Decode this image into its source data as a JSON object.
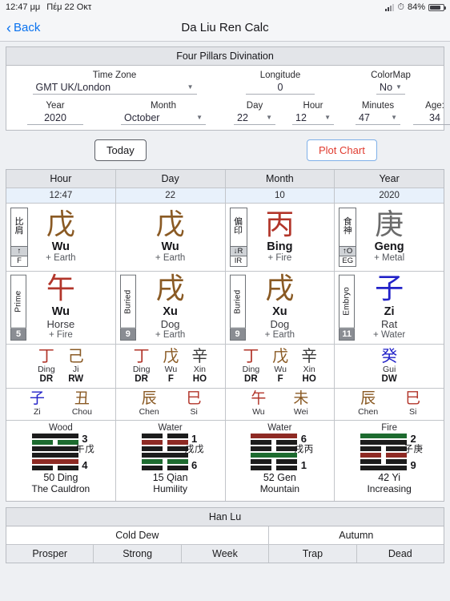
{
  "status_bar": {
    "time": "12:47 μμ",
    "date": "Πέμ 22 Οκτ",
    "battery": "84%",
    "signal_icon": "cellular-signal-icon",
    "wifi_icon": "wifi-icon",
    "battery_icon": "battery-icon"
  },
  "nav": {
    "back_label": "Back",
    "back_icon": "chevron-left-icon",
    "title": "Da Liu Ren Calc"
  },
  "form": {
    "title": "Four Pillars Divination",
    "timezone": {
      "label": "Time Zone",
      "value": "GMT UK/London"
    },
    "longitude": {
      "label": "Longitude",
      "value": "0"
    },
    "colormap": {
      "label": "ColorMap",
      "value": "No"
    },
    "year": {
      "label": "Year",
      "value": "2020"
    },
    "month": {
      "label": "Month",
      "value": "October"
    },
    "day": {
      "label": "Day",
      "value": "22"
    },
    "hour": {
      "label": "Hour",
      "value": "12"
    },
    "minutes": {
      "label": "Minutes",
      "value": "47"
    },
    "age": {
      "label": "Age:",
      "value": "34"
    }
  },
  "buttons": {
    "today": "Today",
    "plot_chart": "Plot Chart"
  },
  "colors": {
    "wood": "#1d6b2f",
    "fire": "#b2352a",
    "earth": "#8a5a24",
    "metal": "#6b6b6b",
    "water": "#2222c8",
    "accent_blue": "#0a72ef",
    "plot_red": "#e03b2f"
  },
  "chart_data": {
    "type": "table",
    "title": "Four Pillars Divination chart",
    "columns": [
      "Hour",
      "Day",
      "Month",
      "Year"
    ],
    "subvalues": [
      "12:47",
      "22",
      "10",
      "2020"
    ],
    "stems": [
      {
        "cn": "戊",
        "pinyin": "Wu",
        "element": "+ Earth",
        "color": "#8a5a24",
        "badge": {
          "cn": "比肩",
          "mid": "↑",
          "bot": "F"
        }
      },
      {
        "cn": "戊",
        "pinyin": "Wu",
        "element": "+ Earth",
        "color": "#8a5a24",
        "badge": null
      },
      {
        "cn": "丙",
        "pinyin": "Bing",
        "element": "+ Fire",
        "color": "#b2352a",
        "badge": {
          "cn": "偏印",
          "mid": "↓R",
          "bot": "IR"
        }
      },
      {
        "cn": "庚",
        "pinyin": "Geng",
        "element": "+ Metal",
        "color": "#6b6b6b",
        "badge": {
          "cn": "食神",
          "mid": "↑O",
          "bot": "EG"
        }
      }
    ],
    "branches": [
      {
        "cn": "午",
        "pinyin": "Wu",
        "animal": "Horse",
        "element": "+ Fire",
        "color": "#b2352a",
        "badge": {
          "text": "Prime",
          "num": "5"
        }
      },
      {
        "cn": "戌",
        "pinyin": "Xu",
        "animal": "Dog",
        "element": "+ Earth",
        "color": "#8a5a24",
        "badge": {
          "text": "Buried",
          "num": "9"
        }
      },
      {
        "cn": "戌",
        "pinyin": "Xu",
        "animal": "Dog",
        "element": "+ Earth",
        "color": "#8a5a24",
        "badge": {
          "text": "Buried",
          "num": "9"
        }
      },
      {
        "cn": "子",
        "pinyin": "Zi",
        "animal": "Rat",
        "element": "+ Water",
        "color": "#2222c8",
        "badge": {
          "text": "Embryo",
          "num": "11"
        }
      }
    ],
    "hidden_stems": [
      [
        {
          "cn": "丁",
          "pinyin": "Ding",
          "abbr": "DR",
          "color": "#b2352a"
        },
        {
          "cn": "己",
          "pinyin": "Ji",
          "abbr": "RW",
          "color": "#8a5a24"
        }
      ],
      [
        {
          "cn": "丁",
          "pinyin": "Ding",
          "abbr": "DR",
          "color": "#b2352a"
        },
        {
          "cn": "戊",
          "pinyin": "Wu",
          "abbr": "F",
          "color": "#8a5a24"
        },
        {
          "cn": "辛",
          "pinyin": "Xin",
          "abbr": "HO",
          "color": "#3a3a3a"
        }
      ],
      [
        {
          "cn": "丁",
          "pinyin": "Ding",
          "abbr": "DR",
          "color": "#b2352a"
        },
        {
          "cn": "戊",
          "pinyin": "Wu",
          "abbr": "F",
          "color": "#8a5a24"
        },
        {
          "cn": "辛",
          "pinyin": "Xin",
          "abbr": "HO",
          "color": "#3a3a3a"
        }
      ],
      [
        {
          "cn": "癸",
          "pinyin": "Gui",
          "abbr": "DW",
          "color": "#2222c8"
        }
      ]
    ],
    "extra_branches": [
      [
        {
          "cn": "子",
          "pinyin": "Zi",
          "color": "#2222c8"
        },
        {
          "cn": "丑",
          "pinyin": "Chou",
          "color": "#8a5a24"
        }
      ],
      [
        {
          "cn": "辰",
          "pinyin": "Chen",
          "color": "#8a5a24"
        },
        {
          "cn": "巳",
          "pinyin": "Si",
          "color": "#b2352a"
        }
      ],
      [
        {
          "cn": "午",
          "pinyin": "Wu",
          "color": "#b2352a"
        },
        {
          "cn": "未",
          "pinyin": "Wei",
          "color": "#8a5a24"
        }
      ],
      [
        {
          "cn": "辰",
          "pinyin": "Chen",
          "color": "#8a5a24"
        },
        {
          "cn": "巳",
          "pinyin": "Si",
          "color": "#b2352a"
        }
      ]
    ],
    "hexagrams": [
      {
        "element": "Wood",
        "top_num": "3",
        "bottom_num": "4",
        "ganzhi": "戊午",
        "name": "50 Ding",
        "meaning": "The Cauldron",
        "lines": [
          {
            "type": "solid",
            "color": "#1c1c1c"
          },
          {
            "type": "broken",
            "color": "#1d6b2f"
          },
          {
            "type": "solid",
            "color": "#1c1c1c"
          },
          {
            "type": "solid",
            "color": "#1c1c1c"
          },
          {
            "type": "solid",
            "color": "#8e2a24"
          },
          {
            "type": "broken",
            "color": "#1c1c1c"
          }
        ]
      },
      {
        "element": "Water",
        "top_num": "1",
        "bottom_num": "6",
        "ganzhi": "戊戌",
        "name": "15 Qian",
        "meaning": "Humility",
        "lines": [
          {
            "type": "broken",
            "color": "#1c1c1c"
          },
          {
            "type": "broken",
            "color": "#8e2a24"
          },
          {
            "type": "broken",
            "color": "#1c1c1c"
          },
          {
            "type": "solid",
            "color": "#1c1c1c"
          },
          {
            "type": "broken",
            "color": "#1d6b2f"
          },
          {
            "type": "broken",
            "color": "#1c1c1c"
          }
        ]
      },
      {
        "element": "Water",
        "top_num": "6",
        "bottom_num": "1",
        "ganzhi": "丙戌",
        "name": "52 Gen",
        "meaning": "Mountain",
        "lines": [
          {
            "type": "solid",
            "color": "#8e2a24"
          },
          {
            "type": "broken",
            "color": "#1c1c1c"
          },
          {
            "type": "broken",
            "color": "#1c1c1c"
          },
          {
            "type": "solid",
            "color": "#1d6b2f"
          },
          {
            "type": "broken",
            "color": "#1c1c1c"
          },
          {
            "type": "broken",
            "color": "#1c1c1c"
          }
        ]
      },
      {
        "element": "Fire",
        "top_num": "2",
        "bottom_num": "9",
        "ganzhi": "庚子",
        "name": "42 Yi",
        "meaning": "Increasing",
        "lines": [
          {
            "type": "solid",
            "color": "#1d6b2f"
          },
          {
            "type": "solid",
            "color": "#1c1c1c"
          },
          {
            "type": "broken",
            "color": "#1c1c1c"
          },
          {
            "type": "broken",
            "color": "#8e2a24"
          },
          {
            "type": "broken",
            "color": "#1c1c1c"
          },
          {
            "type": "solid",
            "color": "#1c1c1c"
          }
        ]
      }
    ]
  },
  "bottom": {
    "title": "Han Lu",
    "row2": [
      "Cold Dew",
      "Autumn"
    ],
    "row3": [
      "Prosper",
      "Strong",
      "Week",
      "Trap",
      "Dead"
    ]
  }
}
